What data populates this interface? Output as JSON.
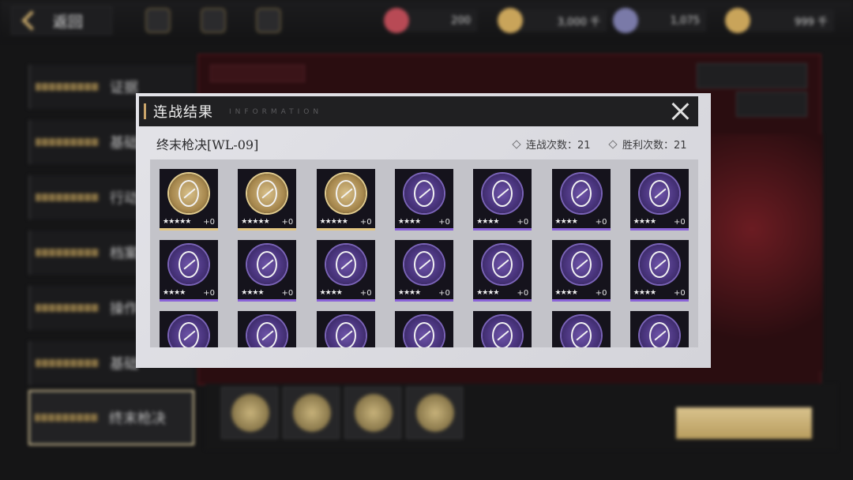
{
  "topbar": {
    "back_label": "返回",
    "resources": [
      {
        "name": "ticket",
        "value": "200",
        "color": "#b84a55"
      },
      {
        "name": "coin-pack",
        "value": "3,000 千",
        "color": "#c9a45a"
      },
      {
        "name": "crystal",
        "value": "1,075",
        "color": "#7a7aa8"
      },
      {
        "name": "gold",
        "value": "999 千",
        "color": "#c9a45a"
      }
    ]
  },
  "left_menu": {
    "items": [
      "证据",
      "基础",
      "行动",
      "档案",
      "操作",
      "基础",
      "终末枪决"
    ]
  },
  "modal": {
    "title": "连战结果",
    "subtitle": "INFORMATION",
    "stage_name": "终末枪决[WL-09]",
    "battle_count_label": "连战次数：21",
    "win_count_label": "胜利次数：21",
    "close_icon": "close-icon"
  },
  "rewards": [
    {
      "rarity": "gold",
      "stars": "★★★★★",
      "plus": "+0"
    },
    {
      "rarity": "gold",
      "stars": "★★★★★",
      "plus": "+0"
    },
    {
      "rarity": "gold",
      "stars": "★★★★★",
      "plus": "+0"
    },
    {
      "rarity": "purple",
      "stars": "★★★★",
      "plus": "+0"
    },
    {
      "rarity": "purple",
      "stars": "★★★★",
      "plus": "+0"
    },
    {
      "rarity": "purple",
      "stars": "★★★★",
      "plus": "+0"
    },
    {
      "rarity": "purple",
      "stars": "★★★★",
      "plus": "+0"
    },
    {
      "rarity": "purple",
      "stars": "★★★★",
      "plus": "+0"
    },
    {
      "rarity": "purple",
      "stars": "★★★★",
      "plus": "+0"
    },
    {
      "rarity": "purple",
      "stars": "★★★★",
      "plus": "+0"
    },
    {
      "rarity": "purple",
      "stars": "★★★★",
      "plus": "+0"
    },
    {
      "rarity": "purple",
      "stars": "★★★★",
      "plus": "+0"
    },
    {
      "rarity": "purple",
      "stars": "★★★★",
      "plus": "+0"
    },
    {
      "rarity": "purple",
      "stars": "★★★★",
      "plus": "+0"
    },
    {
      "rarity": "purple",
      "stars": "",
      "plus": ""
    },
    {
      "rarity": "purple",
      "stars": "",
      "plus": ""
    },
    {
      "rarity": "purple",
      "stars": "",
      "plus": ""
    },
    {
      "rarity": "purple",
      "stars": "",
      "plus": ""
    },
    {
      "rarity": "purple",
      "stars": "",
      "plus": ""
    },
    {
      "rarity": "purple",
      "stars": "",
      "plus": ""
    },
    {
      "rarity": "purple",
      "stars": "",
      "plus": ""
    }
  ]
}
